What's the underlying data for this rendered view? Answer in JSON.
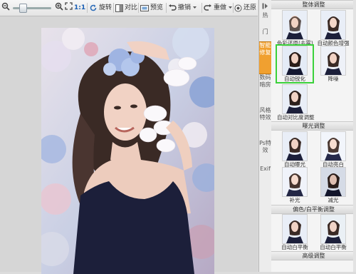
{
  "toolbar": {
    "zoom_ratio": "1:1",
    "rotate_label": "旋转",
    "compare_label": "对比",
    "preview_label": "预览",
    "undo_label": "撤销",
    "redo_label": "重做",
    "restore_label": "还原",
    "zoom_level": 0.25
  },
  "sidebar_tabs": [
    {
      "label": "热"
    },
    {
      "label": "门"
    },
    {
      "label": "智能修复"
    },
    {
      "label": "数码暗房"
    },
    {
      "label": "风格特效"
    },
    {
      "label": "Ps特效"
    },
    {
      "label": "Exif"
    }
  ],
  "panel": {
    "sections": [
      {
        "title": "整体调整",
        "items": [
          {
            "label": "色彩还原(去雾)"
          },
          {
            "label": "自动颜色增强"
          },
          {
            "label": "自动锐化"
          },
          {
            "label": "降噪"
          },
          {
            "label": "自动对比度调整"
          }
        ]
      },
      {
        "title": "曝光调整",
        "items": [
          {
            "label": "自动曝光"
          },
          {
            "label": "自动亮白"
          },
          {
            "label": "补光"
          },
          {
            "label": "减光"
          }
        ]
      },
      {
        "title": "偏色/白平衡调整",
        "items": [
          {
            "label": "自动白平衡"
          },
          {
            "label": "自动白平衡"
          }
        ]
      },
      {
        "title": "高级调整",
        "items": []
      }
    ]
  },
  "colors": {
    "active_tab": "#f0a030",
    "selected_outline": "#3bd13b",
    "dress": "#1c1f3a"
  }
}
